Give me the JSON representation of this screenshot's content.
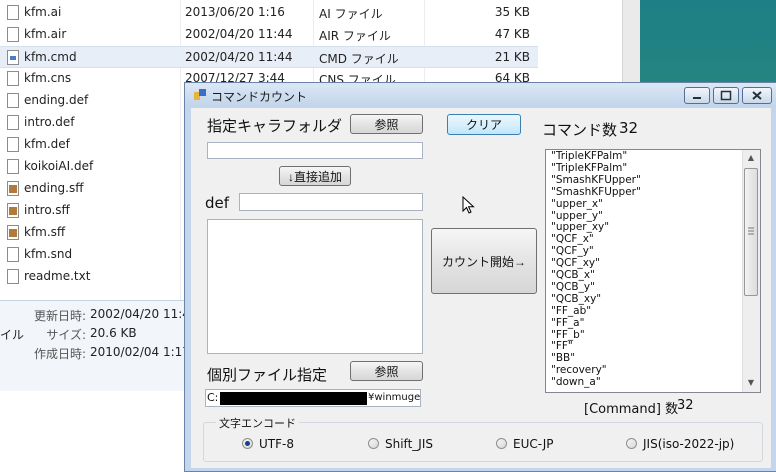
{
  "explorer": {
    "files": [
      {
        "name": "kfm.ai",
        "date": "2013/06/20 1:16",
        "type": "AI ファイル",
        "size": "35 KB",
        "icon": "file-icon"
      },
      {
        "name": "kfm.air",
        "date": "2002/04/20 11:44",
        "type": "AIR ファイル",
        "size": "47 KB",
        "icon": "file-icon"
      },
      {
        "name": "kfm.cmd",
        "date": "2002/04/20 11:44",
        "type": "CMD ファイル",
        "size": "21 KB",
        "icon": "cmd-file-icon",
        "selected": true
      },
      {
        "name": "kfm.cns",
        "date": "2007/12/27 3:44",
        "type": "CNS ファイル",
        "size": "64 KB",
        "icon": "file-icon"
      },
      {
        "name": "ending.def",
        "date": "",
        "type": "",
        "size": "",
        "icon": "file-icon"
      },
      {
        "name": "intro.def",
        "date": "",
        "type": "",
        "size": "",
        "icon": "file-icon"
      },
      {
        "name": "kfm.def",
        "date": "",
        "type": "",
        "size": "",
        "icon": "file-icon"
      },
      {
        "name": "koikoiAI.def",
        "date": "",
        "type": "",
        "size": "",
        "icon": "file-icon"
      },
      {
        "name": "ending.sff",
        "date": "",
        "type": "",
        "size": "",
        "icon": "sff-file-icon"
      },
      {
        "name": "intro.sff",
        "date": "",
        "type": "",
        "size": "",
        "icon": "sff-file-icon"
      },
      {
        "name": "kfm.sff",
        "date": "",
        "type": "",
        "size": "",
        "icon": "sff-file-icon"
      },
      {
        "name": "kfm.snd",
        "date": "",
        "type": "",
        "size": "",
        "icon": "file-icon"
      },
      {
        "name": "readme.txt",
        "date": "",
        "type": "",
        "size": "",
        "icon": "file-icon"
      }
    ],
    "details": {
      "modified_label": "更新日時:",
      "modified_value": "2002/04/20 11:4",
      "size_label": "サイズ:",
      "size_value": "20.6 KB",
      "created_label": "作成日時:",
      "created_value": "2010/02/04 1:17",
      "type_fragment": "イル"
    }
  },
  "dialog": {
    "title": "コマンドカウント",
    "folder_label": "指定キャラフォルダ",
    "browse_folder_label": "参照",
    "clear_label": "クリア",
    "command_count_label": "コマンド数",
    "command_count_value": "32",
    "direct_add_label": "↓直接追加",
    "def_label": "def",
    "start_count_label": "カウント開始→",
    "file_label": "個別ファイル指定",
    "browse_file_label": "参照",
    "path_prefix": "C:",
    "path_suffix": "¥winmugen¥cl",
    "bracket_count_label": "[Command] 数",
    "bracket_count_value": "32",
    "commands": [
      "\"TripleKFPalm\"",
      "\"TripleKFPalm\"",
      "\"SmashKFUpper\"",
      "\"SmashKFUpper\"",
      "\"upper_x\"",
      "\"upper_y\"",
      "\"upper_xy\"",
      "\"QCF_x\"",
      "\"QCF_y\"",
      "\"QCF_xy\"",
      "\"QCB_x\"",
      "\"QCB_y\"",
      "\"QCB_xy\"",
      "\"FF_ab\"",
      "\"FF_a\"",
      "\"FF_b\"",
      "\"FF\"",
      "\"BB\"",
      "\"recovery\"",
      "\"down_a\""
    ],
    "encoding": {
      "group_label": "文字エンコード",
      "options": [
        "UTF-8",
        "Shift_JIS",
        "EUC-JP",
        "JIS(iso-2022-jp)"
      ],
      "selected": "UTF-8"
    }
  }
}
